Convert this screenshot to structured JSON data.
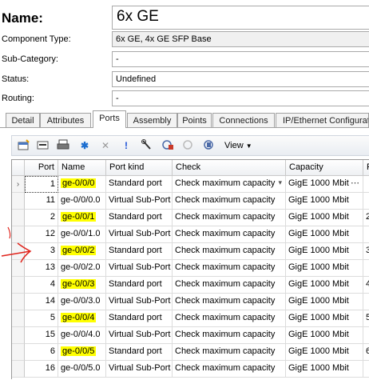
{
  "header": {
    "name_label": "Name:",
    "name_value": "6x GE",
    "component_type_label": "Component Type:",
    "component_type_value": "6x GE, 4x GE SFP Base",
    "sub_category_label": "Sub-Category:",
    "sub_category_value": "-",
    "status_label": "Status:",
    "status_value": "Undefined",
    "routing_label": "Routing:",
    "routing_value": "-"
  },
  "tabs": [
    "Detail",
    "Attributes",
    "Ports",
    "Assembly",
    "Points",
    "Connections",
    "IP/Ethernet Configurati"
  ],
  "active_tab": "Ports",
  "toolbar": {
    "view_label": "View"
  },
  "grid": {
    "columns": [
      "Port",
      "Name",
      "Port kind",
      "Check",
      "Capacity",
      "P"
    ],
    "rows": [
      {
        "port": "1",
        "name": "ge-0/0/0",
        "kind": "Standard port",
        "check": "Check maximum capacity",
        "capacity": "GigE 1000 Mbit",
        "p": "",
        "highlight": true
      },
      {
        "port": "11",
        "name": "ge-0/0/0.0",
        "kind": "Virtual Sub-Port",
        "check": "Check maximum capacity",
        "capacity": "GigE 1000 Mbit",
        "p": "",
        "highlight": false
      },
      {
        "port": "2",
        "name": "ge-0/0/1",
        "kind": "Standard port",
        "check": "Check maximum capacity",
        "capacity": "GigE 1000 Mbit",
        "p": "2",
        "highlight": true
      },
      {
        "port": "12",
        "name": "ge-0/0/1.0",
        "kind": "Virtual Sub-Port",
        "check": "Check maximum capacity",
        "capacity": "GigE 1000 Mbit",
        "p": "",
        "highlight": false
      },
      {
        "port": "3",
        "name": "ge-0/0/2",
        "kind": "Standard port",
        "check": "Check maximum capacity",
        "capacity": "GigE 1000 Mbit",
        "p": "3",
        "highlight": true
      },
      {
        "port": "13",
        "name": "ge-0/0/2.0",
        "kind": "Virtual Sub-Port",
        "check": "Check maximum capacity",
        "capacity": "GigE 1000 Mbit",
        "p": "",
        "highlight": false
      },
      {
        "port": "4",
        "name": "ge-0/0/3",
        "kind": "Standard port",
        "check": "Check maximum capacity",
        "capacity": "GigE 1000 Mbit",
        "p": "4",
        "highlight": true
      },
      {
        "port": "14",
        "name": "ge-0/0/3.0",
        "kind": "Virtual Sub-Port",
        "check": "Check maximum capacity",
        "capacity": "GigE 1000 Mbit",
        "p": "",
        "highlight": false
      },
      {
        "port": "5",
        "name": "ge-0/0/4",
        "kind": "Standard port",
        "check": "Check maximum capacity",
        "capacity": "GigE 1000 Mbit",
        "p": "5",
        "highlight": true
      },
      {
        "port": "15",
        "name": "ge-0/0/4.0",
        "kind": "Virtual Sub-Port",
        "check": "Check maximum capacity",
        "capacity": "GigE 1000 Mbit",
        "p": "",
        "highlight": false
      },
      {
        "port": "6",
        "name": "ge-0/0/5",
        "kind": "Standard port",
        "check": "Check maximum capacity",
        "capacity": "GigE 1000 Mbit",
        "p": "6",
        "highlight": true
      },
      {
        "port": "16",
        "name": "ge-0/0/5.0",
        "kind": "Virtual Sub-Port",
        "check": "Check maximum capacity",
        "capacity": "GigE 1000 Mbit",
        "p": "",
        "highlight": false
      }
    ]
  },
  "colors": {
    "highlight": "#ffff00",
    "annotation_arrow": "#e0241c"
  }
}
